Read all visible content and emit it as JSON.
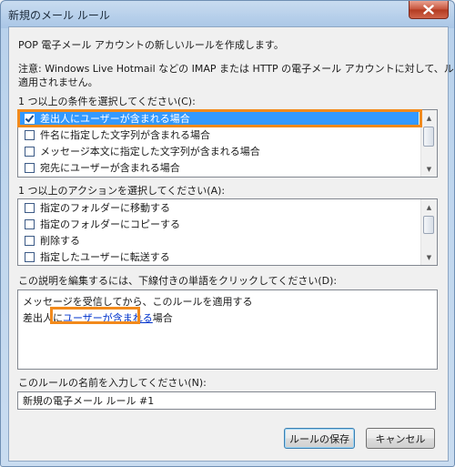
{
  "window": {
    "title": "新規のメール ルール"
  },
  "intro": "POP 電子メール アカウントの新しいルールを作成します。",
  "note_line1": "注意: Windows Live Hotmail などの IMAP または HTTP の電子メール アカウントに対して、ルールは",
  "note_line2": "適用されません。",
  "conditions": {
    "label": "1 つ以上の条件を選択してください(C):",
    "items": [
      {
        "label": "差出人にユーザーが含まれる場合",
        "checked": true,
        "selected": true
      },
      {
        "label": "件名に指定した文字列が含まれる場合",
        "checked": false
      },
      {
        "label": "メッセージ本文に指定した文字列が含まれる場合",
        "checked": false
      },
      {
        "label": "宛先にユーザーが含まれる場合",
        "checked": false
      }
    ]
  },
  "actions": {
    "label": "1 つ以上のアクションを選択してください(A):",
    "items": [
      {
        "label": "指定のフォルダーに移動する",
        "checked": false
      },
      {
        "label": "指定のフォルダーにコピーする",
        "checked": false
      },
      {
        "label": "削除する",
        "checked": false
      },
      {
        "label": "指定したユーザーに転送する",
        "checked": false
      }
    ]
  },
  "description": {
    "label": "この説明を編集するには、下線付きの単語をクリックしてください(D):",
    "line1": "メッセージを受信してから、このルールを適用する",
    "line2_prefix": "差出人に",
    "line2_link": "ユーザーが含まれる",
    "line2_suffix": "場合"
  },
  "rule_name": {
    "label": "このルールの名前を入力してください(N):",
    "value": "新規の電子メール ルール #1"
  },
  "buttons": {
    "save": "ルールの保存",
    "cancel": "キャンセル"
  },
  "colors": {
    "highlight": "#f28a1c",
    "selection": "#3399ff",
    "link": "#0033cc"
  }
}
